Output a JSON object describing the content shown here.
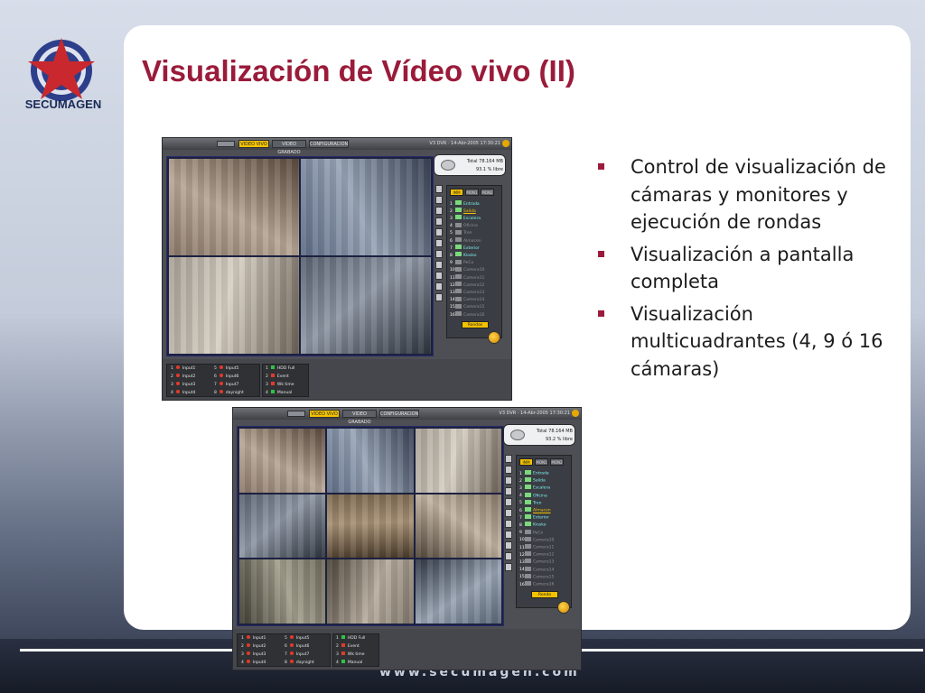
{
  "slide": {
    "title": "Visualización de Vídeo vivo (II)",
    "logo_text": "SECUMAGEN",
    "footer_url": "www.secumagen.com",
    "bullets": [
      "Control de visualización de cámaras y monitores y ejecución de rondas",
      "Visualización a pantalla completa",
      "Visualización multicuadrantes (4, 9 ó 16 cámaras)"
    ]
  },
  "colors": {
    "title": "#9a1b3a",
    "accent_yellow": "#f3c200",
    "dvr_frame": "#4d4f54"
  },
  "dvr1": {
    "menu": [
      "VIDEO VIVO",
      "VIDEO GRABADO",
      "CONFIGURACION"
    ],
    "active_menu": "VIDEO VIVO",
    "status": "V3 DVR · 14-Abr-2005 17:30:21",
    "disk_total_label": "Total",
    "disk_total": "78.164 MB",
    "disk_free": "93.1 % libre",
    "monitors": [
      "IMM",
      "MON1",
      "MON2"
    ],
    "rondas_label": "Rondas",
    "cameras": [
      {
        "n": "1",
        "name": "Entrada",
        "on": true
      },
      {
        "n": "2",
        "name": "Salida",
        "on": true,
        "sel": true
      },
      {
        "n": "3",
        "name": "Escalera",
        "on": true
      },
      {
        "n": "4",
        "name": "Oficina",
        "on": false
      },
      {
        "n": "5",
        "name": "Tren",
        "on": false
      },
      {
        "n": "6",
        "name": "Almacen",
        "on": false
      },
      {
        "n": "7",
        "name": "Exterior",
        "on": true
      },
      {
        "n": "8",
        "name": "Kiosko",
        "on": true
      },
      {
        "n": "9",
        "name": "PeCo",
        "on": false
      },
      {
        "n": "10",
        "name": "Camera10",
        "on": false
      },
      {
        "n": "11",
        "name": "Camera11",
        "on": false
      },
      {
        "n": "12",
        "name": "Camera12",
        "on": false
      },
      {
        "n": "13",
        "name": "Camera13",
        "on": false
      },
      {
        "n": "14",
        "name": "Camera14",
        "on": false
      },
      {
        "n": "15",
        "name": "Camera15",
        "on": false
      },
      {
        "n": "16",
        "name": "Camera16",
        "on": false
      }
    ],
    "inputs": [
      {
        "n": "1",
        "name": "Input1"
      },
      {
        "n": "2",
        "name": "Input2"
      },
      {
        "n": "3",
        "name": "Input3"
      },
      {
        "n": "4",
        "name": "Input4"
      },
      {
        "n": "5",
        "name": "Input5"
      },
      {
        "n": "6",
        "name": "Input6"
      },
      {
        "n": "7",
        "name": "Input7"
      },
      {
        "n": "8",
        "name": "daynight"
      }
    ],
    "events": [
      {
        "n": "1",
        "name": "HDD Full"
      },
      {
        "n": "2",
        "name": "Event"
      },
      {
        "n": "3",
        "name": "Wk time"
      },
      {
        "n": "4",
        "name": "Manual"
      }
    ]
  },
  "dvr2": {
    "menu": [
      "VIDEO VIVO",
      "VIDEO GRABADO",
      "CONFIGURACION"
    ],
    "active_menu": "VIDEO VIVO",
    "status": "V3 DVR · 14-Abr-2005 17:30:21",
    "disk_total_label": "Total",
    "disk_total": "78.164 MB",
    "disk_free": "93.2 % libre",
    "monitors": [
      "IMM",
      "MON1",
      "MON2"
    ],
    "rondas_label": "Ronda",
    "cameras": [
      {
        "n": "1",
        "name": "Entrada",
        "on": true
      },
      {
        "n": "2",
        "name": "Salida",
        "on": true
      },
      {
        "n": "3",
        "name": "Escalera",
        "on": true
      },
      {
        "n": "4",
        "name": "Oficina",
        "on": true
      },
      {
        "n": "5",
        "name": "Tren",
        "on": true
      },
      {
        "n": "6",
        "name": "Almacen",
        "on": true,
        "sel": true
      },
      {
        "n": "7",
        "name": "Exterior",
        "on": true
      },
      {
        "n": "8",
        "name": "Kiosko",
        "on": true
      },
      {
        "n": "9",
        "name": "PeCo",
        "on": false
      },
      {
        "n": "10",
        "name": "Camera10",
        "on": false
      },
      {
        "n": "11",
        "name": "Camera11",
        "on": false
      },
      {
        "n": "12",
        "name": "Camera12",
        "on": false
      },
      {
        "n": "13",
        "name": "Camera13",
        "on": false
      },
      {
        "n": "14",
        "name": "Camera14",
        "on": false
      },
      {
        "n": "15",
        "name": "Camera15",
        "on": false
      },
      {
        "n": "16",
        "name": "Camera16",
        "on": false
      }
    ],
    "inputs": [
      {
        "n": "1",
        "name": "Input1"
      },
      {
        "n": "2",
        "name": "Input2"
      },
      {
        "n": "3",
        "name": "Input3"
      },
      {
        "n": "4",
        "name": "Input4"
      },
      {
        "n": "5",
        "name": "Input5"
      },
      {
        "n": "6",
        "name": "Input6"
      },
      {
        "n": "7",
        "name": "Input7"
      },
      {
        "n": "8",
        "name": "daynight"
      }
    ],
    "events": [
      {
        "n": "1",
        "name": "HDD Full"
      },
      {
        "n": "2",
        "name": "Event"
      },
      {
        "n": "3",
        "name": "Wk time"
      },
      {
        "n": "4",
        "name": "Manual"
      }
    ]
  }
}
